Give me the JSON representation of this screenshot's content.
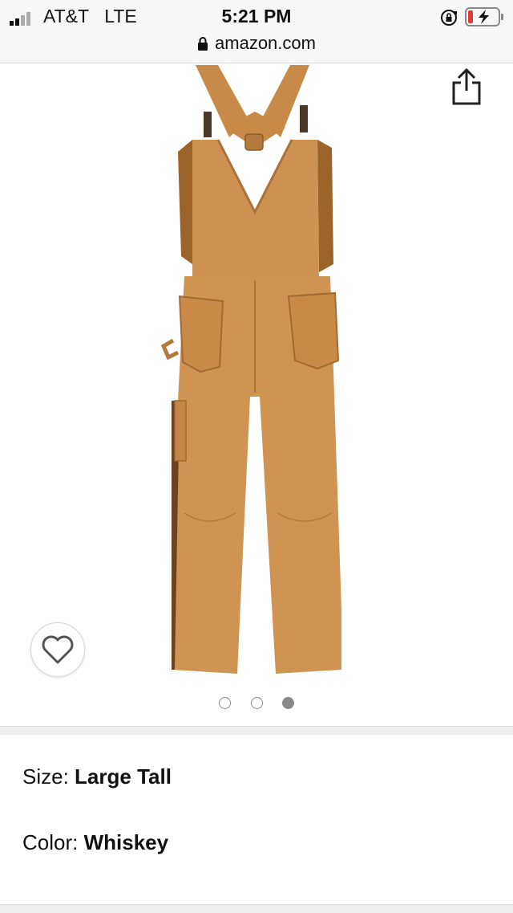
{
  "status_bar": {
    "carrier": "AT&T",
    "network": "LTE",
    "time": "5:21 PM",
    "url": "amazon.com",
    "battery_charging": true,
    "battery_color": "#e53935"
  },
  "product": {
    "image_alt_subject": "overalls-back-view",
    "image_color": "#c98a48",
    "carousel": {
      "total": 3,
      "active_index": 2
    }
  },
  "variations": {
    "size_label": "Size:",
    "size_value": "Large Tall",
    "color_label": "Color:",
    "color_value": "Whiskey"
  },
  "icons": {
    "share": "share-icon",
    "wishlist": "heart-icon",
    "lock": "lock-icon",
    "rotation_lock": "rotation-lock-icon"
  }
}
